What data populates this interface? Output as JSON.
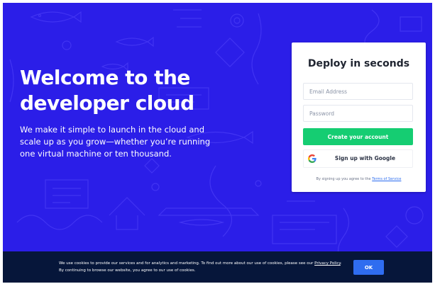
{
  "hero": {
    "title": "Welcome to the developer cloud",
    "subtitle": "We make it simple to launch in the cloud and scale up as you grow—whether you’re running one virtual machine or ten thousand."
  },
  "signup_card": {
    "title": "Deploy in seconds",
    "email_placeholder": "Email Address",
    "password_placeholder": "Password",
    "create_button": "Create your account",
    "google_button": "Sign up with Google",
    "google_icon": "google-g-logo",
    "terms_prefix": "By signing up you agree to the ",
    "terms_link": "Terms of Service"
  },
  "cookie_banner": {
    "text_part1": "We use cookies to provide our services and for analytics and marketing. To find out more about our use of cookies, please see our ",
    "privacy_link": "Privacy Policy",
    "text_part2": ". By continuing to browse our website, you agree to our use of cookies.",
    "ok_button": "OK"
  },
  "colors": {
    "background": "#2b1ee8",
    "doodle_line": "#5a4cff",
    "primary_green": "#15cd72",
    "cookie_bar": "#06163a",
    "ok_blue": "#2f6df0",
    "link_blue": "#2b6cf0"
  }
}
